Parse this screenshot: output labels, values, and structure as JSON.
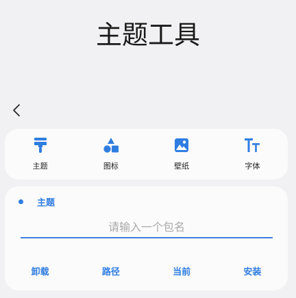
{
  "header": {
    "title": "主题工具"
  },
  "nav": {
    "back_icon": "chevron-left-icon"
  },
  "tabs": [
    {
      "label": "主题",
      "icon": "paint-roller-icon"
    },
    {
      "label": "图标",
      "icon": "shapes-icon"
    },
    {
      "label": "壁纸",
      "icon": "image-icon"
    },
    {
      "label": "字体",
      "icon": "font-size-icon"
    }
  ],
  "form": {
    "section_label": "主题",
    "package_input": {
      "value": "",
      "placeholder": "请输入一个包名"
    },
    "actions": [
      {
        "label": "卸载"
      },
      {
        "label": "路径"
      },
      {
        "label": "当前"
      },
      {
        "label": "安装"
      }
    ]
  },
  "colors": {
    "accent": "#2f7de1",
    "background": "#f1f1f3",
    "card": "#fbfbfb"
  }
}
